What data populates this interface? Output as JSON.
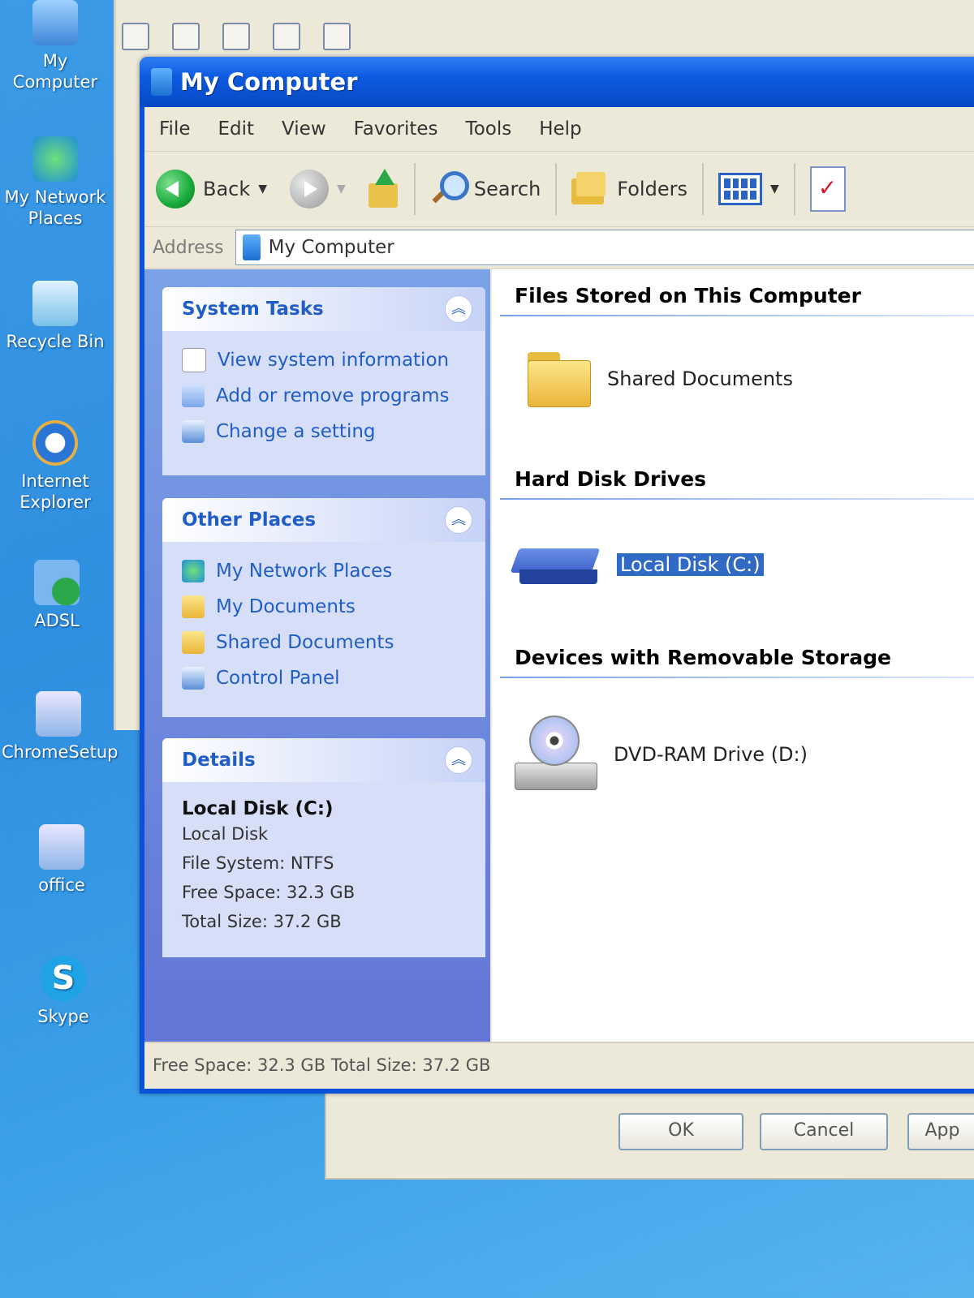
{
  "desktop": {
    "icons": [
      {
        "label": "My Computer"
      },
      {
        "label": "My Network Places"
      },
      {
        "label": "Recycle Bin"
      },
      {
        "label": "Internet Explorer"
      },
      {
        "label": "ADSL"
      },
      {
        "label": "ChromeSetup"
      },
      {
        "label": "office"
      },
      {
        "label": "Skype"
      }
    ]
  },
  "window": {
    "title": "My Computer"
  },
  "menu": {
    "items": [
      "File",
      "Edit",
      "View",
      "Favorites",
      "Tools",
      "Help"
    ]
  },
  "toolbar": {
    "back_label": "Back",
    "search_label": "Search",
    "folders_label": "Folders"
  },
  "address": {
    "label": "Address",
    "value": "My Computer"
  },
  "tasks": {
    "system": {
      "title": "System Tasks",
      "items": [
        "View system information",
        "Add or remove programs",
        "Change a setting"
      ]
    },
    "other": {
      "title": "Other Places",
      "items": [
        "My Network Places",
        "My Documents",
        "Shared Documents",
        "Control Panel"
      ]
    },
    "details": {
      "title": "Details",
      "name": "Local Disk (C:)",
      "type": "Local Disk",
      "filesystem": "File System: NTFS",
      "free": "Free Space: 32.3 GB",
      "total": "Total Size: 37.2 GB"
    }
  },
  "content": {
    "groups": {
      "files": {
        "title": "Files Stored on This Computer",
        "item": "Shared Documents"
      },
      "hdd": {
        "title": "Hard Disk Drives",
        "item": "Local Disk (C:)"
      },
      "removable": {
        "title": "Devices with Removable Storage",
        "item": "DVD-RAM Drive (D:)"
      }
    }
  },
  "statusbar": {
    "text": "Free Space: 32.3 GB Total Size: 37.2 GB"
  },
  "dialog": {
    "ok": "OK",
    "cancel": "Cancel",
    "apply": "App"
  }
}
